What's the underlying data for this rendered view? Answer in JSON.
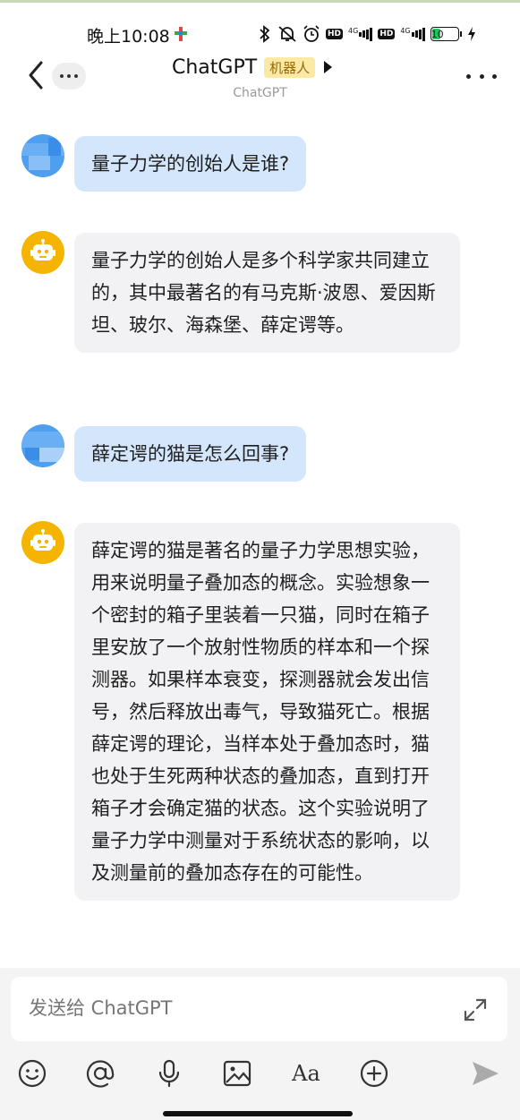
{
  "status_bar": {
    "time": "晚上10:08",
    "battery": "10"
  },
  "nav": {
    "title": "ChatGPT",
    "badge": "机器人",
    "subtitle": "ChatGPT"
  },
  "messages": [
    {
      "role": "user",
      "text": "量子力学的创始人是谁?"
    },
    {
      "role": "bot",
      "text": "量子力学的创始人是多个科学家共同建立的，其中最著名的有马克斯·波恩、爱因斯坦、玻尔、海森堡、薛定谔等。"
    },
    {
      "role": "user",
      "text": "薛定谔的猫是怎么回事?"
    },
    {
      "role": "bot",
      "text": "薛定谔的猫是著名的量子力学思想实验，用来说明量子叠加态的概念。实验想象一个密封的箱子里装着一只猫，同时在箱子里安放了一个放射性物质的样本和一个探测器。如果样本衰变，探测器就会发出信号，然后释放出毒气，导致猫死亡。根据薛定谔的理论，当样本处于叠加态时，猫也处于生死两种状态的叠加态，直到打开箱子才会确定猫的状态。这个实验说明了量子力学中测量对于系统状态的影响，以及测量前的叠加态存在的可能性。"
    }
  ],
  "composer": {
    "placeholder": "发送给 ChatGPT",
    "font_button": "Aa"
  },
  "colors": {
    "user_bubble": "#d4e6fc",
    "bot_bubble": "#f2f2f4",
    "bot_avatar": "#f5b400",
    "badge_bg": "#fbe9a6"
  }
}
